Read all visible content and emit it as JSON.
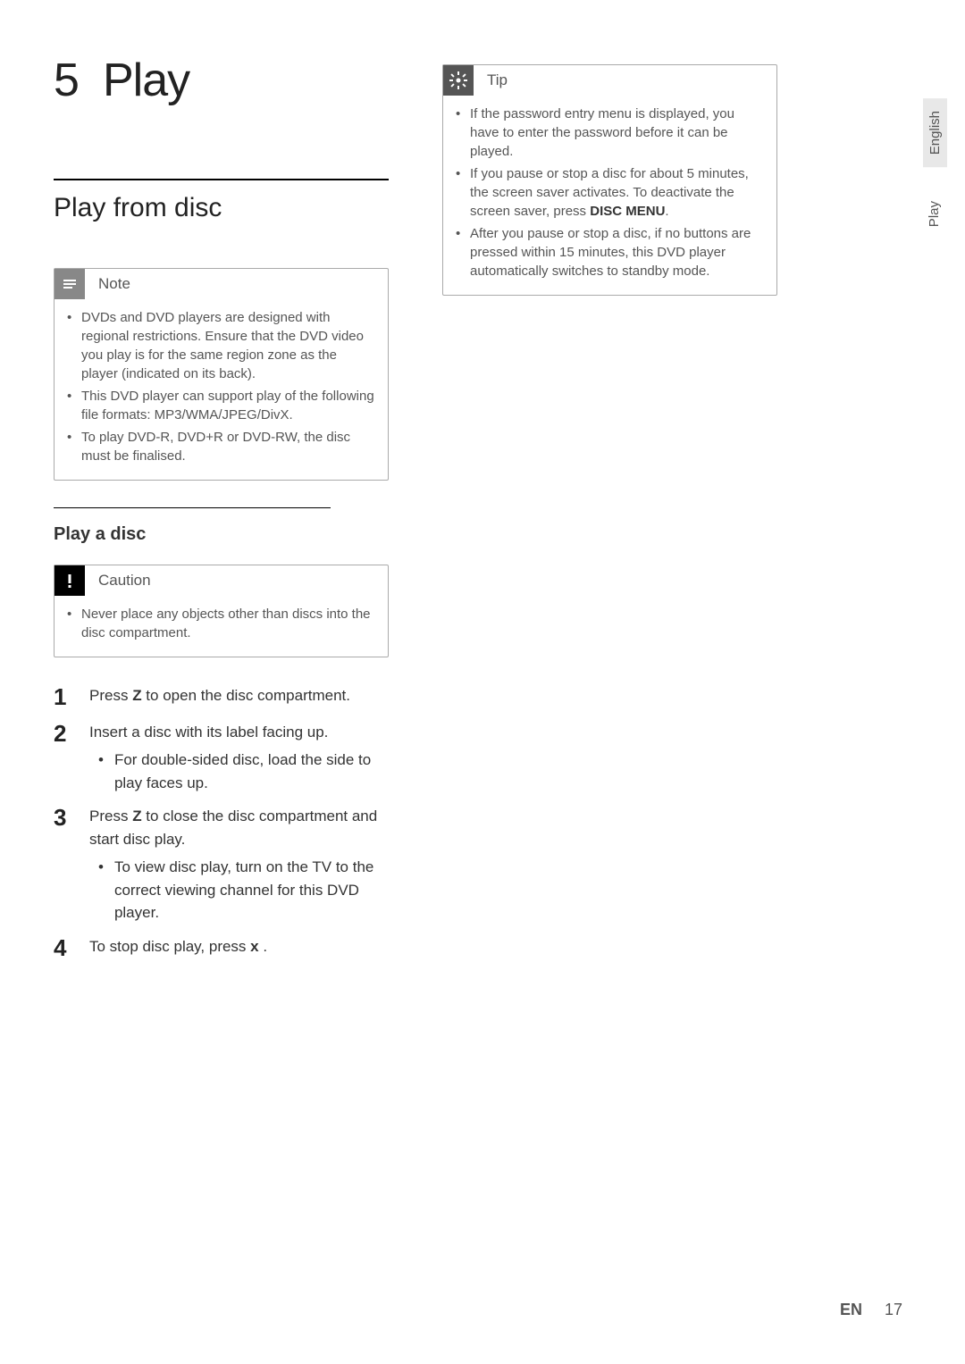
{
  "chapter": {
    "number": "5",
    "title": "Play"
  },
  "section": {
    "title": "Play from disc"
  },
  "note": {
    "label": "Note",
    "items": [
      "DVDs and DVD players are designed with regional restrictions. Ensure that the DVD video you play is for the same region zone as the player (indicated on its back).",
      "This DVD player can support play of the following file formats: MP3/WMA/JPEG/DivX.",
      "To play DVD-R, DVD+R or DVD-RW, the disc must be finalised."
    ]
  },
  "subsection": {
    "title": "Play a disc"
  },
  "caution": {
    "label": "Caution",
    "items": [
      "Never place any objects other than discs into the disc compartment."
    ]
  },
  "steps": [
    {
      "n": "1",
      "text_before": "Press ",
      "symbol": "Z",
      "text_after": "  to open the disc compartment.",
      "sub": null
    },
    {
      "n": "2",
      "text_before": "Insert a disc with its label facing up.",
      "symbol": "",
      "text_after": "",
      "sub": "For double-sided disc, load the side to play faces up."
    },
    {
      "n": "3",
      "text_before": "Press ",
      "symbol": "Z",
      "text_after": "  to close the disc compartment and start disc play.",
      "sub": "To view disc play, turn on the TV to the correct viewing channel for this DVD player."
    },
    {
      "n": "4",
      "text_before": "To stop disc play, press ",
      "symbol": "x",
      "text_after": " .",
      "sub": null
    }
  ],
  "tip": {
    "label": "Tip",
    "items": [
      {
        "pre": "If the password entry menu is displayed, you have to enter the password before it can be played.",
        "bold": "",
        "post": ""
      },
      {
        "pre": "If you pause or stop a disc for about 5 minutes, the screen saver activates. To deactivate the screen saver, press ",
        "bold": "DISC MENU",
        "post": "."
      },
      {
        "pre": "After you pause or stop a disc, if no buttons are pressed within 15 minutes, this DVD player automatically switches to standby mode.",
        "bold": "",
        "post": ""
      }
    ]
  },
  "tabs": {
    "lang": "English",
    "section": "Play"
  },
  "footer": {
    "lang": "EN",
    "page": "17"
  }
}
